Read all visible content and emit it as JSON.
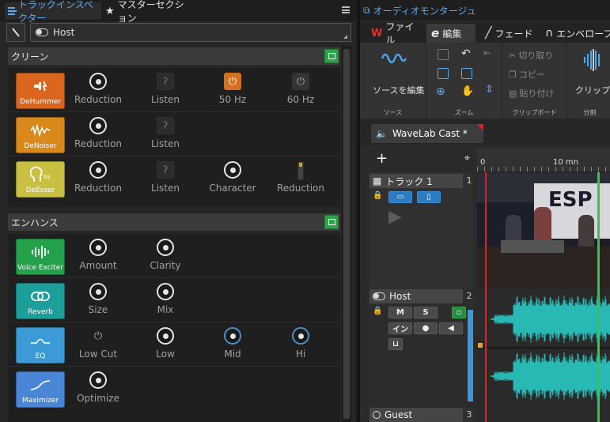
{
  "inspector": {
    "tabs": [
      {
        "label": "トラックインスペクター",
        "icon": "list-icon"
      },
      {
        "label": "マスターセクション",
        "icon": "star-icon"
      }
    ],
    "host_field": "Host",
    "sections": [
      {
        "title": "クリーン",
        "plugins": [
          {
            "name": "DeHummer",
            "color": "#d9661c",
            "params": [
              {
                "label": "Reduction",
                "control": "knob"
              },
              {
                "label": "Listen",
                "control": "ear-button"
              },
              {
                "label": "50 Hz",
                "control": "power-on"
              },
              {
                "label": "60 Hz",
                "control": "power-off"
              }
            ]
          },
          {
            "name": "DeNoiser",
            "color": "#d9891a",
            "params": [
              {
                "label": "Reduction",
                "control": "knob"
              },
              {
                "label": "Listen",
                "control": "ear-button"
              }
            ]
          },
          {
            "name": "DeEsser",
            "color": "#c9c043",
            "params": [
              {
                "label": "Reduction",
                "control": "knob"
              },
              {
                "label": "Listen",
                "control": "ear-button"
              },
              {
                "label": "Character",
                "control": "knob"
              },
              {
                "label": "Reduction",
                "control": "meter"
              }
            ]
          }
        ]
      },
      {
        "title": "エンハンス",
        "plugins": [
          {
            "name": "Voice Exciter",
            "color": "#23a14b",
            "params": [
              {
                "label": "Amount",
                "control": "knob"
              },
              {
                "label": "Clarity",
                "control": "knob"
              }
            ]
          },
          {
            "name": "Reverb",
            "color": "#1c9e9a",
            "params": [
              {
                "label": "Size",
                "control": "knob"
              },
              {
                "label": "Mix",
                "control": "knob"
              }
            ]
          },
          {
            "name": "EQ",
            "color": "#3c9bd7",
            "params": [
              {
                "label": "Low Cut",
                "control": "power-off"
              },
              {
                "label": "Low",
                "control": "knob"
              },
              {
                "label": "Mid",
                "control": "knob-hi"
              },
              {
                "label": "Hi",
                "control": "knob-hi"
              }
            ]
          },
          {
            "name": "Maximizer",
            "color": "#4a86d6",
            "params": [
              {
                "label": "Optimize",
                "control": "knob"
              }
            ]
          }
        ]
      }
    ]
  },
  "montage": {
    "title": "オーディオモンタージュ",
    "tabs": [
      "ファイル",
      "編集",
      "フェード",
      "エンベロープ"
    ],
    "active_tab": "編集",
    "ribbon": {
      "source_group": "ソース",
      "source_button": "ソースを編集",
      "zoom_group": "ズーム",
      "clipboard_group": "クリップボード",
      "clipboard_items": [
        "切り取り",
        "コピー",
        "貼り付け"
      ],
      "split_group": "分割",
      "split_button": "クリップを分"
    },
    "montage_tab": "WaveLab Cast *",
    "ruler": {
      "start": "0",
      "mark": "10 mn"
    },
    "tracks": [
      {
        "number": "1",
        "name": "トラック 1",
        "type": "video"
      },
      {
        "number": "2",
        "name": "Host",
        "type": "audio",
        "buttons": [
          "M",
          "S",
          "イン"
        ]
      },
      {
        "number": "3",
        "name": "Guest",
        "type": "audio"
      }
    ],
    "colors": {
      "playhead": "#e02020",
      "cursor": "#3ac24a",
      "waveform": "#29b9b4",
      "accent": "#5aaaf0"
    }
  }
}
